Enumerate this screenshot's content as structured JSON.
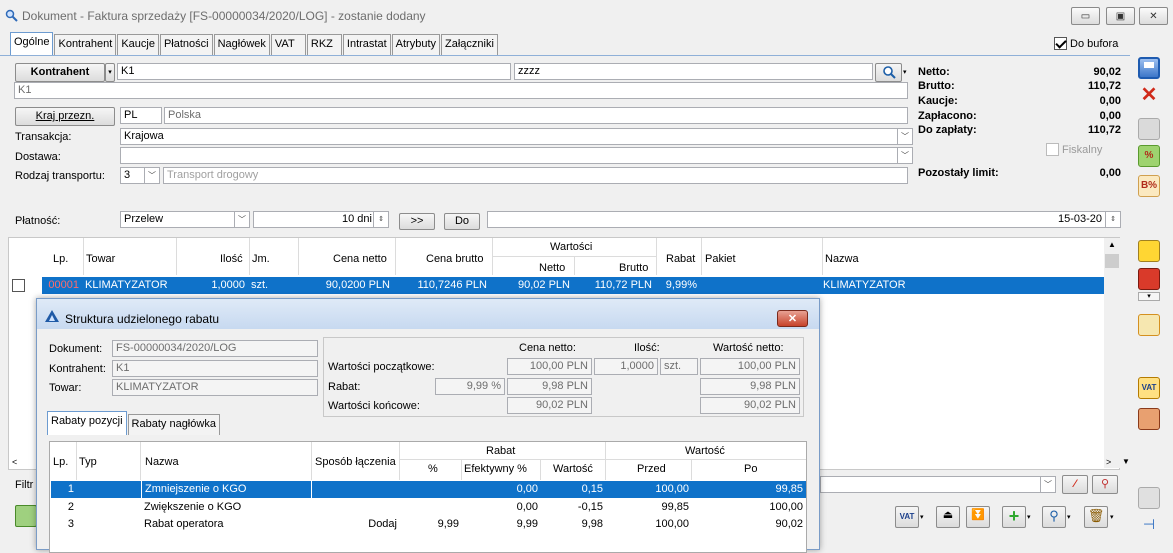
{
  "window": {
    "title": "Dokument - Faktura sprzedaży [FS-00000034/2020/LOG]  - zostanie dodany",
    "minimize": "▭",
    "maximize": "▣",
    "close": "✕"
  },
  "tabs": [
    "Ogólne",
    "Kontrahent",
    "Kaucje",
    "Płatności",
    "Nagłówek",
    "VAT",
    "RKZ",
    "Intrastat",
    "Atrybuty",
    "Załączniki"
  ],
  "do_bufora": {
    "label": "Do bufora",
    "checked": true
  },
  "kontrahent": {
    "button": "Kontrahent",
    "code": "K1",
    "name": "zzzz",
    "subname": "K1"
  },
  "kraj": {
    "button": "Kraj przezn.",
    "code": "PL",
    "name": "Polska"
  },
  "transakcja": {
    "label": "Transakcja:",
    "value": "Krajowa"
  },
  "dostawa": {
    "label": "Dostawa:",
    "value": ""
  },
  "rodzaj_transportu": {
    "label": "Rodzaj transportu:",
    "code": "3",
    "name": "Transport drogowy"
  },
  "platnosc": {
    "label": "Płatność:",
    "method": "Przelew",
    "days": "10 dni",
    "btn_next": ">>",
    "btn_do": "Do",
    "date": "15-03-20"
  },
  "summary": {
    "netto_label": "Netto:",
    "netto": "90,02",
    "brutto_label": "Brutto:",
    "brutto": "110,72",
    "kaucje_label": "Kaucje:",
    "kaucje": "0,00",
    "zaplacono_label": "Zapłacono:",
    "zaplacono": "0,00",
    "do_zaplaty_label": "Do zapłaty:",
    "do_zaplaty": "110,72",
    "fiskalny": "Fiskalny",
    "limit_label": "Pozostały limit:",
    "limit": "0,00"
  },
  "items_grid": {
    "headers": {
      "lp": "Lp.",
      "towar": "Towar",
      "ilosc": "Ilość",
      "jm": "Jm.",
      "cena_netto": "Cena netto",
      "cena_brutto": "Cena brutto",
      "wartosci": "Wartości",
      "netto": "Netto",
      "brutto": "Brutto",
      "rabat": "Rabat",
      "pakiet": "Pakiet",
      "nazwa": "Nazwa"
    },
    "row": {
      "lp": "00001",
      "towar": "KLIMATYZATOR",
      "ilosc": "1,0000",
      "jm": "szt.",
      "cena_netto": "90,0200 PLN",
      "cena_brutto": "110,7246 PLN",
      "netto": "90,02 PLN",
      "brutto": "110,72 PLN",
      "rabat": "9,99%",
      "pakiet": "",
      "nazwa": "KLIMATYZATOR"
    },
    "filter_label": "Filtr"
  },
  "dialog": {
    "title": "Struktura udzielonego rabatu",
    "close": "✕",
    "dokument_label": "Dokument:",
    "dokument": "FS-00000034/2020/LOG",
    "kontrahent_label": "Kontrahent:",
    "kontrahent": "K1",
    "towar_label": "Towar:",
    "towar": "KLIMATYZATOR",
    "col_cena": "Cena netto:",
    "col_ilosc": "Ilość:",
    "col_wartosc": "Wartość netto:",
    "pocz_label": "Wartości początkowe:",
    "pocz_cena": "100,00 PLN",
    "pocz_ilosc": "1,0000",
    "pocz_jm": "szt.",
    "pocz_wartosc": "100,00 PLN",
    "rabat_label": "Rabat:",
    "rabat_pct": "9,99 %",
    "rabat_cena": "9,98 PLN",
    "rabat_wartosc": "9,98 PLN",
    "konc_label": "Wartości końcowe:",
    "konc_cena": "90,02 PLN",
    "konc_wartosc": "90,02 PLN",
    "tabs": [
      "Rabaty pozycji",
      "Rabaty nagłówka"
    ],
    "grid_headers": {
      "lp": "Lp.",
      "typ": "Typ",
      "nazwa": "Nazwa",
      "sposob": "Sposób łączenia",
      "rabat": "Rabat",
      "pct": "%",
      "efektywny": "Efektywny %",
      "wartosc_r": "Wartość",
      "wartosc": "Wartość",
      "przed": "Przed",
      "po": "Po"
    },
    "rows": [
      {
        "lp": "1",
        "typ": "",
        "nazwa": "Zmniejszenie o KGO",
        "sposob": "",
        "pct": "",
        "efektywny": "0,00",
        "wartosc": "0,15",
        "przed": "100,00",
        "po": "99,85"
      },
      {
        "lp": "2",
        "typ": "",
        "nazwa": "Zwiększenie o KGO",
        "sposob": "",
        "pct": "",
        "efektywny": "0,00",
        "wartosc": "-0,15",
        "przed": "99,85",
        "po": "100,00"
      },
      {
        "lp": "3",
        "typ": "",
        "nazwa": "Rabat operatora",
        "sposob": "Dodaj",
        "pct": "9,99",
        "efektywny": "9,99",
        "wartosc": "9,98",
        "przed": "100,00",
        "po": "90,02"
      }
    ]
  },
  "colors": {
    "selection": "#0f72c9",
    "accent": "#6c9bd0"
  }
}
